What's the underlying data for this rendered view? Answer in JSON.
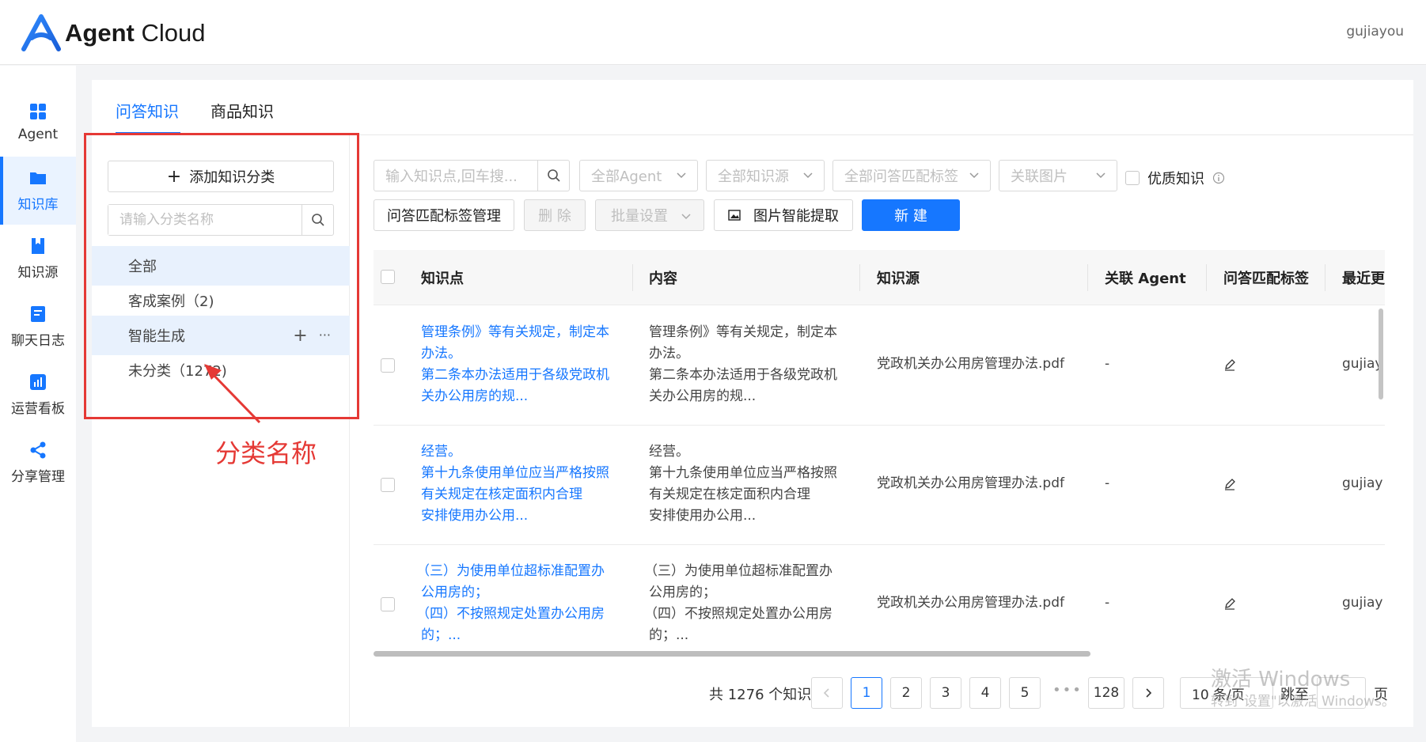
{
  "app": {
    "brand_bold": "Agent",
    "brand_light": "Cloud",
    "user": "gujiayou"
  },
  "nav": [
    {
      "label": "Agent",
      "icon": "grid-icon",
      "active": false
    },
    {
      "label": "知识库",
      "icon": "folder-icon",
      "active": true
    },
    {
      "label": "知识源",
      "icon": "book-icon",
      "active": false
    },
    {
      "label": "聊天日志",
      "icon": "log-icon",
      "active": false
    },
    {
      "label": "运营看板",
      "icon": "dashboard-icon",
      "active": false
    },
    {
      "label": "分享管理",
      "icon": "share-icon",
      "active": false
    }
  ],
  "tabs": [
    "问答知识",
    "商品知识"
  ],
  "categories": {
    "add_label": "添加知识分类",
    "search_placeholder": "请输入分类名称",
    "items": [
      "全部",
      "客成案例（2)",
      "智能生成",
      "未分类（1272)"
    ]
  },
  "annotation": "分类名称",
  "filters": {
    "search_placeholder": "输入知识点,回车搜...",
    "agent": "全部Agent",
    "source": "全部知识源",
    "tag": "全部问答匹配标签",
    "image": "关联图片",
    "quality": "优质知识"
  },
  "actions": {
    "tag_manage": "问答匹配标签管理",
    "delete": "删 除",
    "batch": "批量设置",
    "image_extract": "图片智能提取",
    "new": "新 建"
  },
  "table": {
    "headers": [
      "知识点",
      "内容",
      "知识源",
      "关联 Agent",
      "问答匹配标签",
      "最近更新"
    ],
    "rows": [
      {
        "point": [
          "管理条例》等有关规定，制定本",
          "办法。",
          "第二条本办法适用于各级党政机",
          "关办公用房的规..."
        ],
        "content": [
          "管理条例》等有关规定，制定本",
          "办法。",
          "第二条本办法适用于各级党政机",
          "关办公用房的规..."
        ],
        "source": "党政机关办公用房管理办法.pdf",
        "agent": "-",
        "updater": "gujiay"
      },
      {
        "point": [
          "经营。",
          "第十九条使用单位应当严格按照",
          "有关规定在核定面积内合理",
          "安排使用办公用..."
        ],
        "content": [
          "经营。",
          "第十九条使用单位应当严格按照",
          "有关规定在核定面积内合理",
          "安排使用办公用..."
        ],
        "source": "党政机关办公用房管理办法.pdf",
        "agent": "-",
        "updater": "gujiay"
      },
      {
        "point": [
          "（三）为使用单位超标准配置办",
          "公用房的；",
          "（四）不按照规定处置办公用房",
          "的；..."
        ],
        "content": [
          "（三）为使用单位超标准配置办",
          "公用房的；",
          "（四）不按照规定处置办公用房",
          "的；..."
        ],
        "source": "党政机关办公用房管理办法.pdf",
        "agent": "-",
        "updater": "gujiay"
      }
    ]
  },
  "pagination": {
    "total": "共 1276 个知识",
    "pages": [
      "1",
      "2",
      "3",
      "4",
      "5"
    ],
    "ellipsis": "•••",
    "last": "128",
    "current": "1",
    "page_size": "10 条/页",
    "jump_label": "跳至",
    "page_suffix": "页"
  },
  "watermark": {
    "line1": "激活 Windows",
    "line2": "转到\"设置\"以激活 Windows。"
  },
  "colors": {
    "accent": "#1677ff",
    "annotation": "#e53935"
  }
}
